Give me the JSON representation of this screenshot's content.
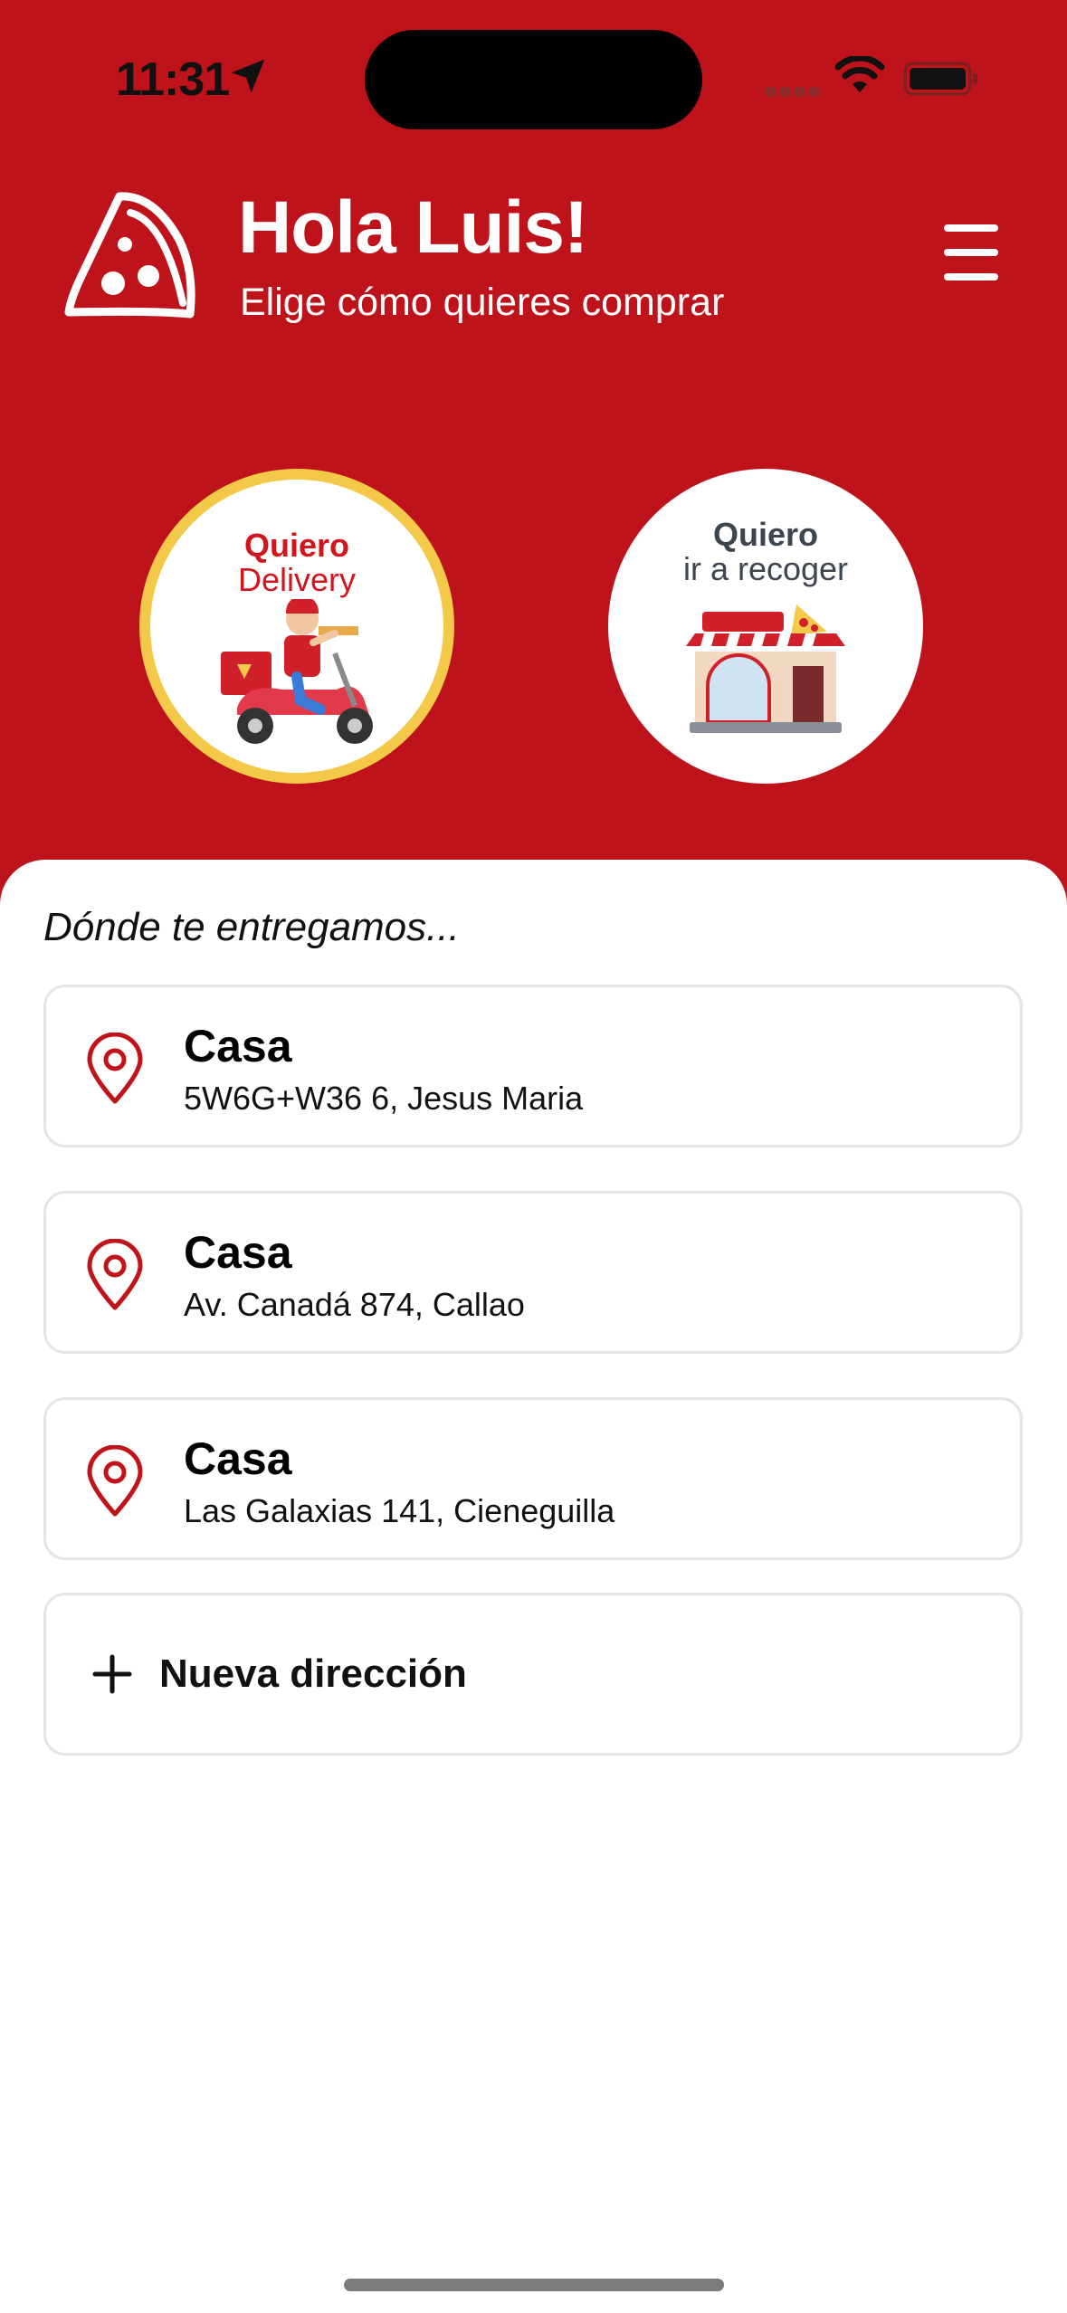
{
  "status_bar": {
    "time": "11:31",
    "icons": [
      "location-arrow-icon",
      "cellular-signal-icon",
      "wifi-icon",
      "battery-icon"
    ]
  },
  "header": {
    "greeting": "Hola Luis!",
    "subtitle": "Elige cómo quieres comprar",
    "logo_icon": "pizza-slice-icon",
    "menu_icon": "hamburger-menu-icon"
  },
  "options": {
    "delivery": {
      "line1": "Quiero",
      "line2": "Delivery",
      "selected": true
    },
    "pickup": {
      "line1": "Quiero",
      "line2": "ir a recoger",
      "selected": false
    }
  },
  "delivery_section": {
    "title": "Dónde te entregamos...",
    "addresses": [
      {
        "name": "Casa",
        "address": "5W6G+W36 6, Jesus Maria"
      },
      {
        "name": "Casa",
        "address": "Av. Canadá 874, Callao"
      },
      {
        "name": "Casa",
        "address": "Las Galaxias 141, Cieneguilla"
      }
    ],
    "new_address_label": "Nueva dirección"
  },
  "colors": {
    "brand_red": "#BE131A",
    "selected_ring": "#F4C94A",
    "card_border": "#E4E4E4"
  }
}
